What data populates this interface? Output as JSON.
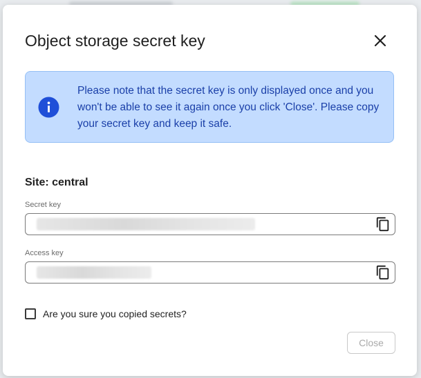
{
  "dialog": {
    "title": "Object storage secret key",
    "close_icon": "close-icon"
  },
  "alert": {
    "icon": "info-icon",
    "message": "Please note that the secret key is only displayed once and you won't be able to see it again once you click 'Close'. Please copy your secret key and keep it safe."
  },
  "site": {
    "label": "Site: central"
  },
  "secret_key": {
    "label": "Secret key",
    "value": "",
    "copy_icon": "copy-icon"
  },
  "access_key": {
    "label": "Access key",
    "value": "",
    "copy_icon": "copy-icon"
  },
  "confirm": {
    "label": "Are you sure you copied secrets?",
    "checked": false
  },
  "footer": {
    "close_label": "Close",
    "close_disabled": true
  },
  "colors": {
    "alert_bg": "#c3dcff",
    "alert_border": "#94bff5",
    "alert_text": "#1a3fa8",
    "info_icon": "#1f4fd8"
  }
}
